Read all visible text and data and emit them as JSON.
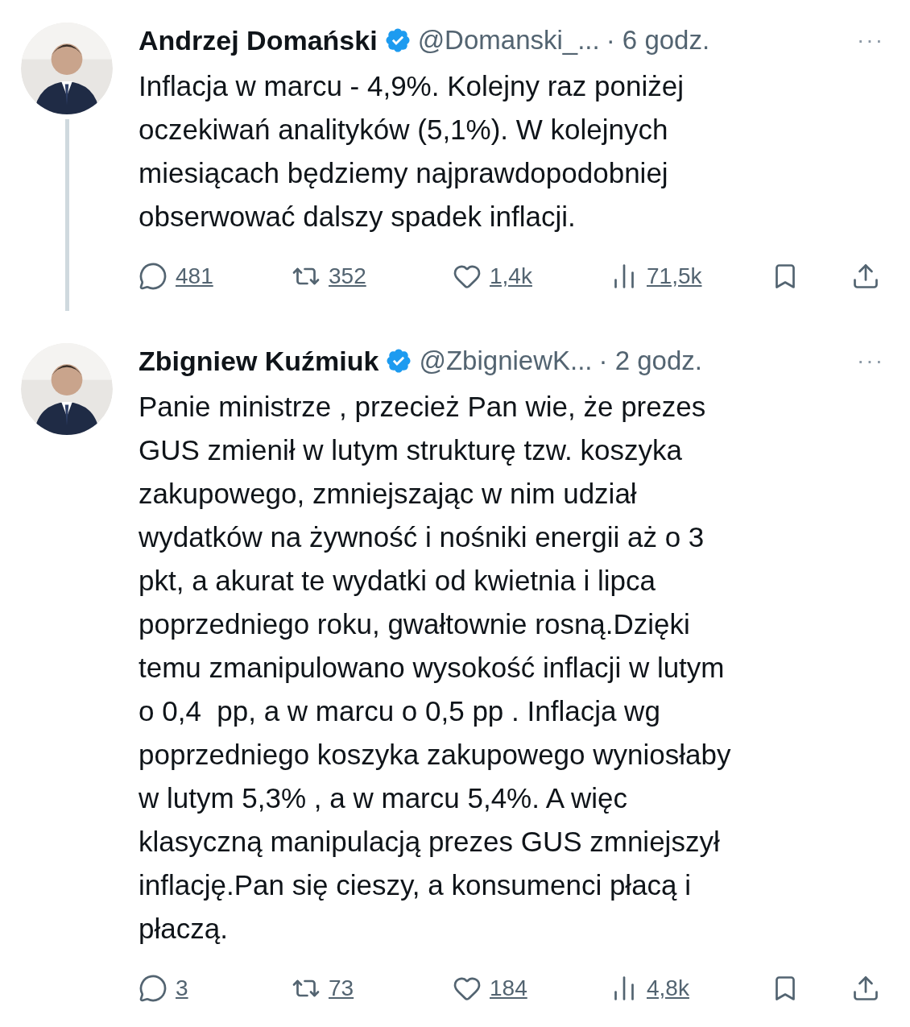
{
  "tweets": [
    {
      "author": "Andrzej Domański",
      "verified": true,
      "handle": "@Domanski_...",
      "time": "· 6 godz.",
      "more": "···",
      "connected": true,
      "text_lines": [
        "Inflacja w marcu - 4,9%. Kolejny raz poniżej",
        "oczekiwań analityków (5,1%). W kolejnych",
        "miesiącach będziemy najprawdopodobniej",
        "obserwować dalszy spadek inflacji."
      ],
      "replies": "481",
      "reposts": "352",
      "likes": "1,4k",
      "views": "71,5k"
    },
    {
      "author": "Zbigniew Kuźmiuk",
      "verified": true,
      "handle": "@ZbigniewK...",
      "time": "· 2 godz.",
      "more": "···",
      "connected": false,
      "text_lines": [
        "Panie ministrze , przecież Pan wie, że prezes",
        "GUS zmienił w lutym strukturę tzw. koszyka",
        "zakupowego, zmniejszając w nim udział",
        "wydatków na żywność i nośniki energii aż o 3",
        "pkt, a akurat te wydatki od kwietnia i lipca",
        "poprzedniego roku, gwałtownie rosną.Dzięki",
        "temu zmanipulowano wysokość inflacji w lutym",
        "o 0,4  pp, a w marcu o 0,5 pp . Inflacja wg",
        "poprzedniego koszyka zakupowego wyniosłaby",
        "w lutym 5,3% , a w marcu 5,4%. A więc",
        "klasyczną manipulacją prezes GUS zmniejszył",
        "inflację.Pan się cieszy, a konsumenci płacą i",
        "płaczą."
      ],
      "replies": "3",
      "reposts": "73",
      "likes": "184",
      "views": "4,8k"
    }
  ]
}
